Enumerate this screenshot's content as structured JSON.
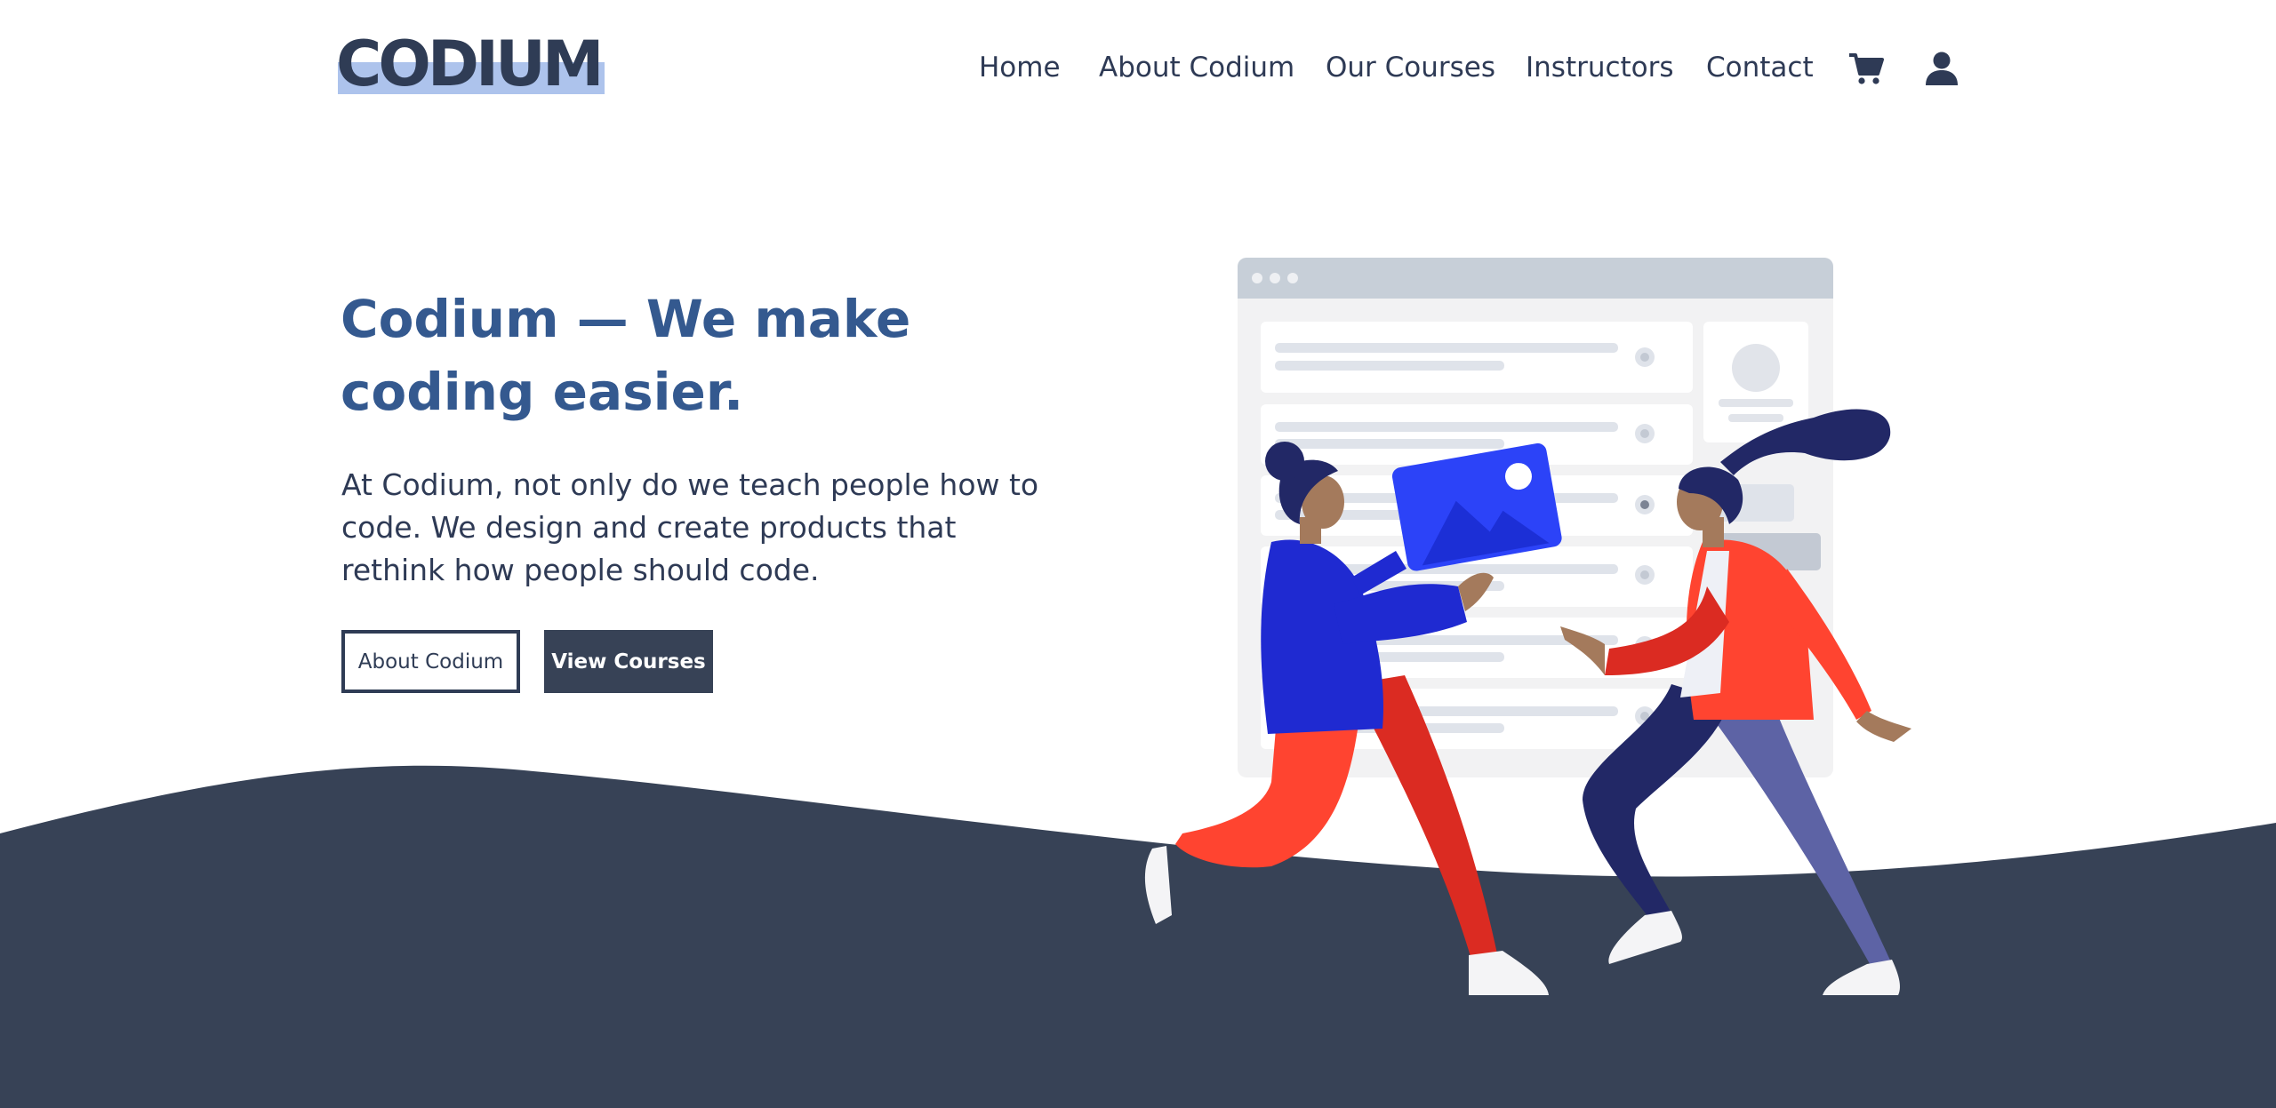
{
  "brand": {
    "logo_text": "CODIUM"
  },
  "nav": {
    "items": [
      {
        "label": "Home"
      },
      {
        "label": "About Codium"
      },
      {
        "label": "Our Courses"
      },
      {
        "label": "Instructors"
      },
      {
        "label": "Contact"
      }
    ],
    "cart_icon": "cart-icon",
    "user_icon": "user-icon"
  },
  "hero": {
    "title": "Codium — We make coding easier.",
    "text": "At Codium, not only do we teach people how to code. We design and create products that rethink how people should code.",
    "buttons": {
      "about_label": "About Codium",
      "courses_label": "View Courses"
    }
  },
  "colors": {
    "brand_dark": "#374256",
    "title_blue": "#34598f",
    "logo_highlight": "#adc3ec",
    "wave": "#374256"
  }
}
